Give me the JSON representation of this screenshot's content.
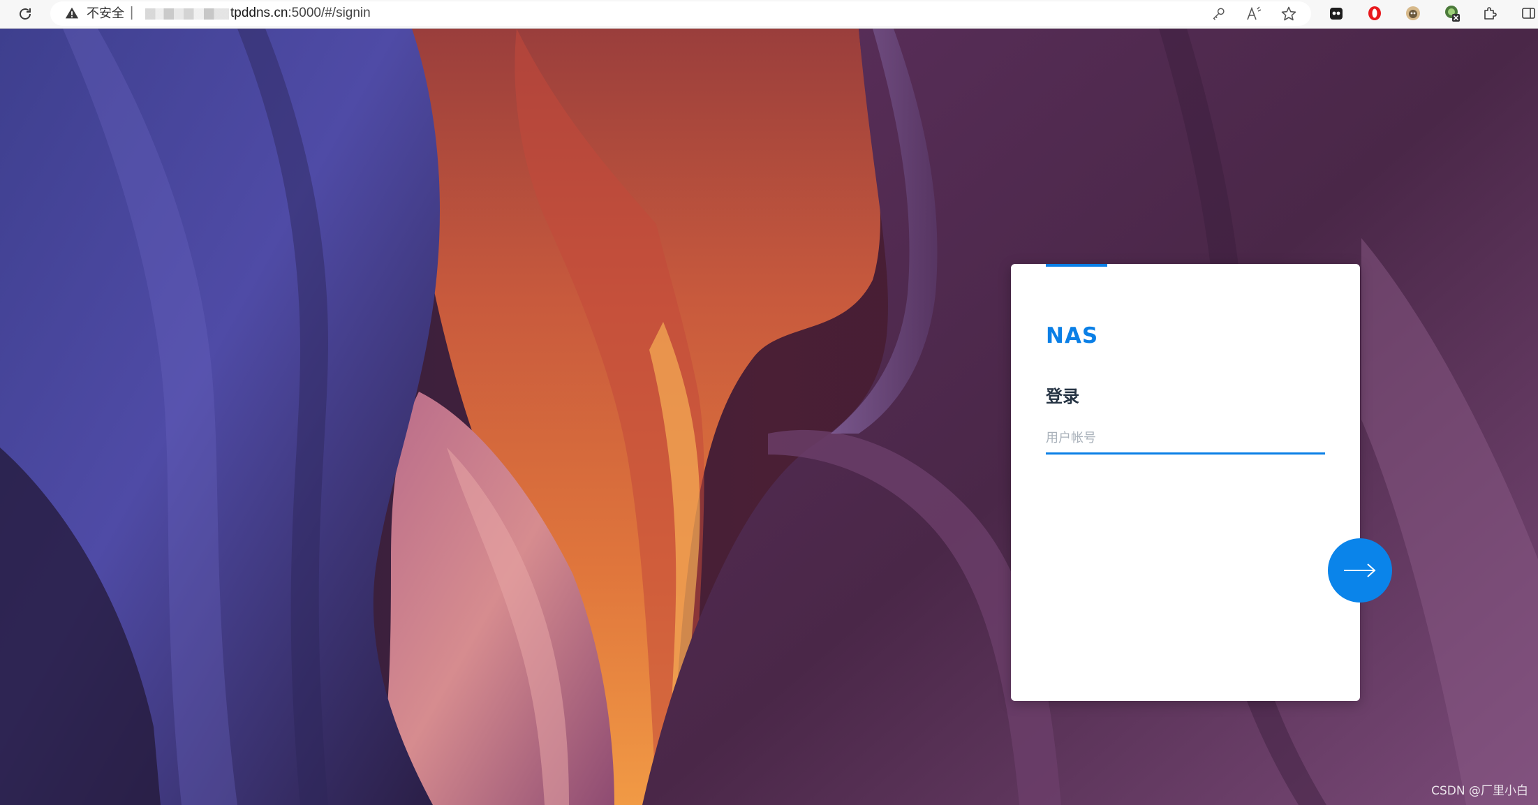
{
  "browser": {
    "address_bar": {
      "security_label": "不安全",
      "separator": "|",
      "url_host": "tpddns.cn",
      "url_rest": ":5000/#/signin"
    },
    "icons": [
      "reload-icon",
      "warning-icon",
      "key-icon",
      "read-aloud-icon",
      "favorite-star-icon",
      "extension-ghost-icon",
      "extension-opera-icon",
      "extension-avatar-icon",
      "extension-badge-icon",
      "extensions-puzzle-icon",
      "sidebar-icon"
    ]
  },
  "login": {
    "brand": "NAS",
    "heading": "登录",
    "username_placeholder": "用户帐号"
  },
  "colors": {
    "accent": "#0a7fe6",
    "heading": "#253343",
    "card": "#ffffff"
  },
  "watermark": "CSDN @厂里小白"
}
